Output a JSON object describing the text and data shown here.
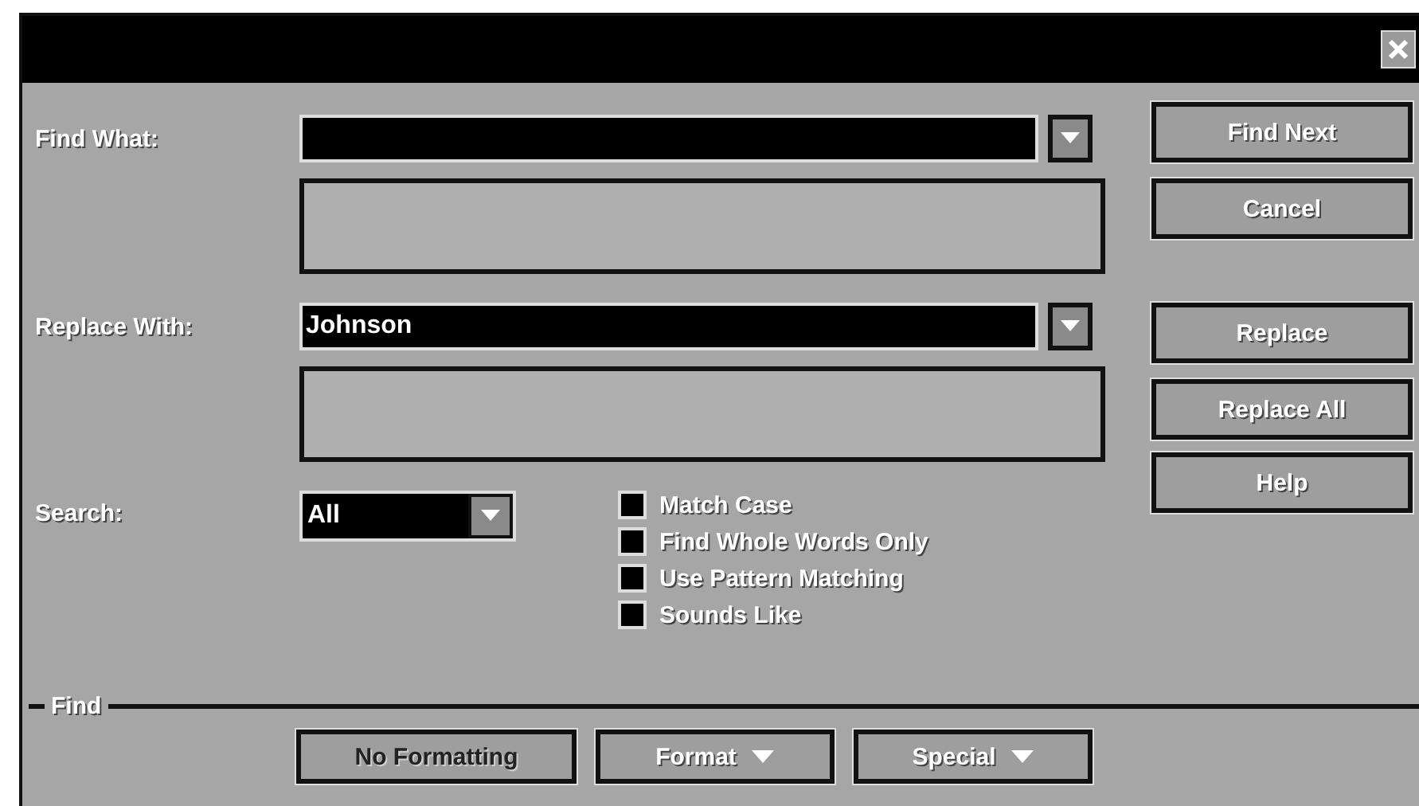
{
  "find_what": {
    "label": "Find What:"
  },
  "replace_with": {
    "label": "Replace With:",
    "value": "Johnson"
  },
  "search": {
    "label": "Search:",
    "value": "All"
  },
  "options": [
    {
      "label": "Match Case",
      "checked": false
    },
    {
      "label": "Find Whole Words Only",
      "checked": false
    },
    {
      "label": "Use Pattern Matching",
      "checked": false
    },
    {
      "label": "Sounds Like",
      "checked": false
    }
  ],
  "buttons": [
    {
      "label": "Find Next"
    },
    {
      "label": "Cancel"
    },
    {
      "label": "Replace"
    },
    {
      "label": "Replace All"
    },
    {
      "label": "Help"
    }
  ],
  "find_group": {
    "label": "Find",
    "buttons": [
      {
        "label": "No Formatting",
        "kind": "plain",
        "disabled": true
      },
      {
        "label": "Format",
        "kind": "menu",
        "disabled": false
      },
      {
        "label": "Special",
        "kind": "menu",
        "disabled": false
      }
    ]
  }
}
